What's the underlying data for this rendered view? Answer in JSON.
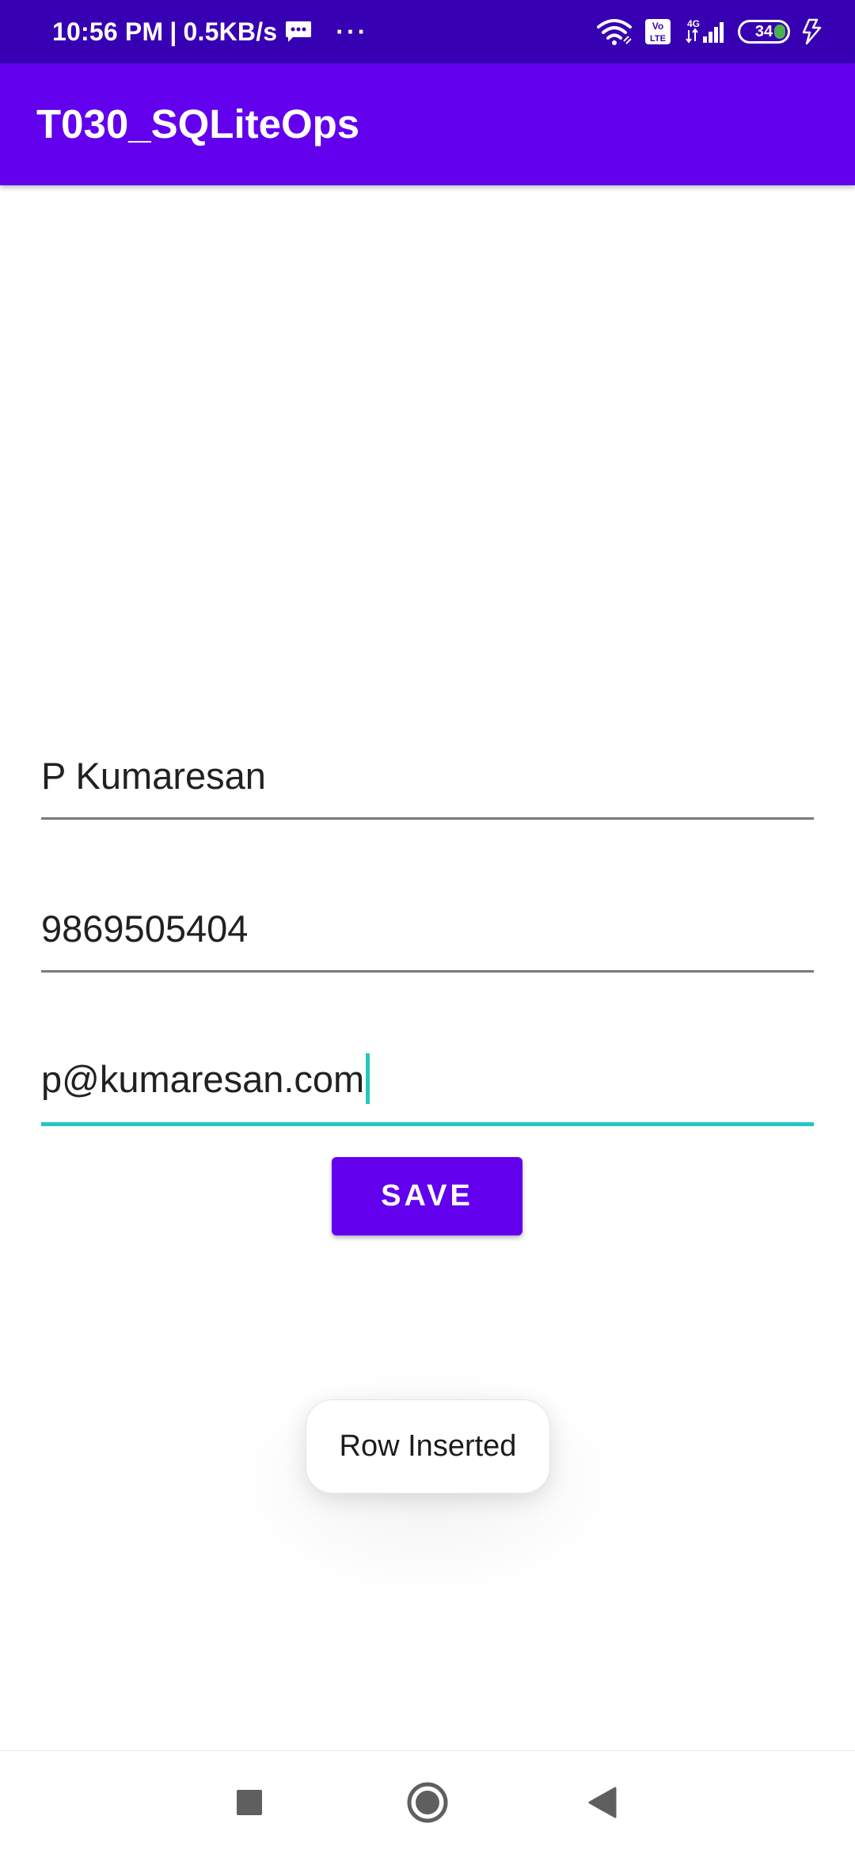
{
  "status_bar": {
    "time": "10:56 PM",
    "separator": "|",
    "net_speed": "0.5KB/s",
    "more": "···",
    "battery_level": "34",
    "icons": [
      "message-icon",
      "wifi-icon",
      "volte-icon",
      "signal-4g-icon",
      "battery-icon",
      "charging-icon"
    ]
  },
  "app_bar": {
    "title": "T030_SQLiteOps"
  },
  "form": {
    "name_value": "P Kumaresan",
    "phone_value": "9869505404",
    "email_value": "p@kumaresan.com",
    "save_label": "SAVE"
  },
  "toast": {
    "message": "Row Inserted"
  },
  "colors": {
    "status_bar": "#3700B3",
    "primary": "#6200EE",
    "accent": "#26C6C0",
    "text": "#212121"
  },
  "nav_bar": {
    "buttons": [
      "recent-apps-icon",
      "home-icon",
      "back-icon"
    ]
  }
}
